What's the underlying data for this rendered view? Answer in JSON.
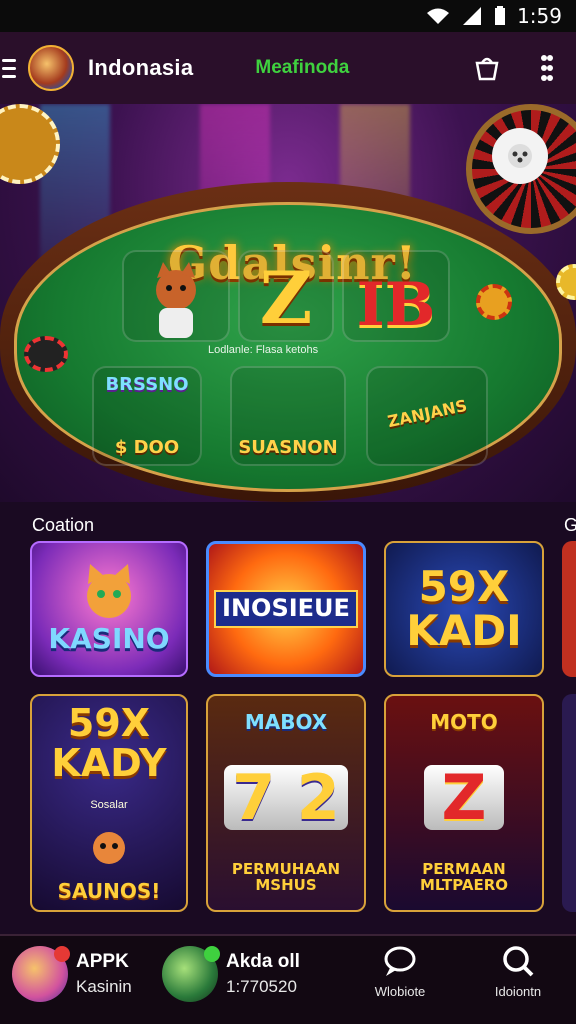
{
  "status_bar": {
    "time": "1:59"
  },
  "header": {
    "title": "Indonasia",
    "subtitle": "Meafinoda",
    "colors": {
      "accent": "#3fd13f",
      "bg": "#2a0f2a"
    }
  },
  "banner": {
    "title": "Gdalsinr!",
    "caption": "Lodlanle: Flasa ketohs",
    "tiles": [
      {
        "label": ""
      },
      {
        "label": "Z"
      },
      {
        "label": "IB"
      },
      {
        "label": "$ DOO",
        "top": "BRSSNO"
      },
      {
        "label": "SUASNON"
      },
      {
        "label": "ZANJANS"
      }
    ]
  },
  "section": {
    "title": "Coation",
    "right_peek": "G"
  },
  "games": [
    {
      "title": "KASINO"
    },
    {
      "title": "INOSIEUE"
    },
    {
      "title": "59X KADI"
    },
    {
      "title": "59X KADY",
      "sub": "SAUNOS!",
      "mini": "Sosalar"
    },
    {
      "title": "7 2",
      "top": "MABOX",
      "sub": "PERMUHAAN MSHUS"
    },
    {
      "title": "Z",
      "top": "MOTO",
      "sub": "PERMAAN MLTPAERO"
    }
  ],
  "bottom_bar": {
    "items": [
      {
        "title": "APPK",
        "sub": "Kasinin"
      },
      {
        "title": "Akda oll",
        "sub": "1:770520"
      }
    ],
    "nav": [
      {
        "label": "Wlobiote",
        "icon": "chat-bubble-icon"
      },
      {
        "label": "Idoiontn",
        "icon": "search-icon"
      }
    ]
  }
}
